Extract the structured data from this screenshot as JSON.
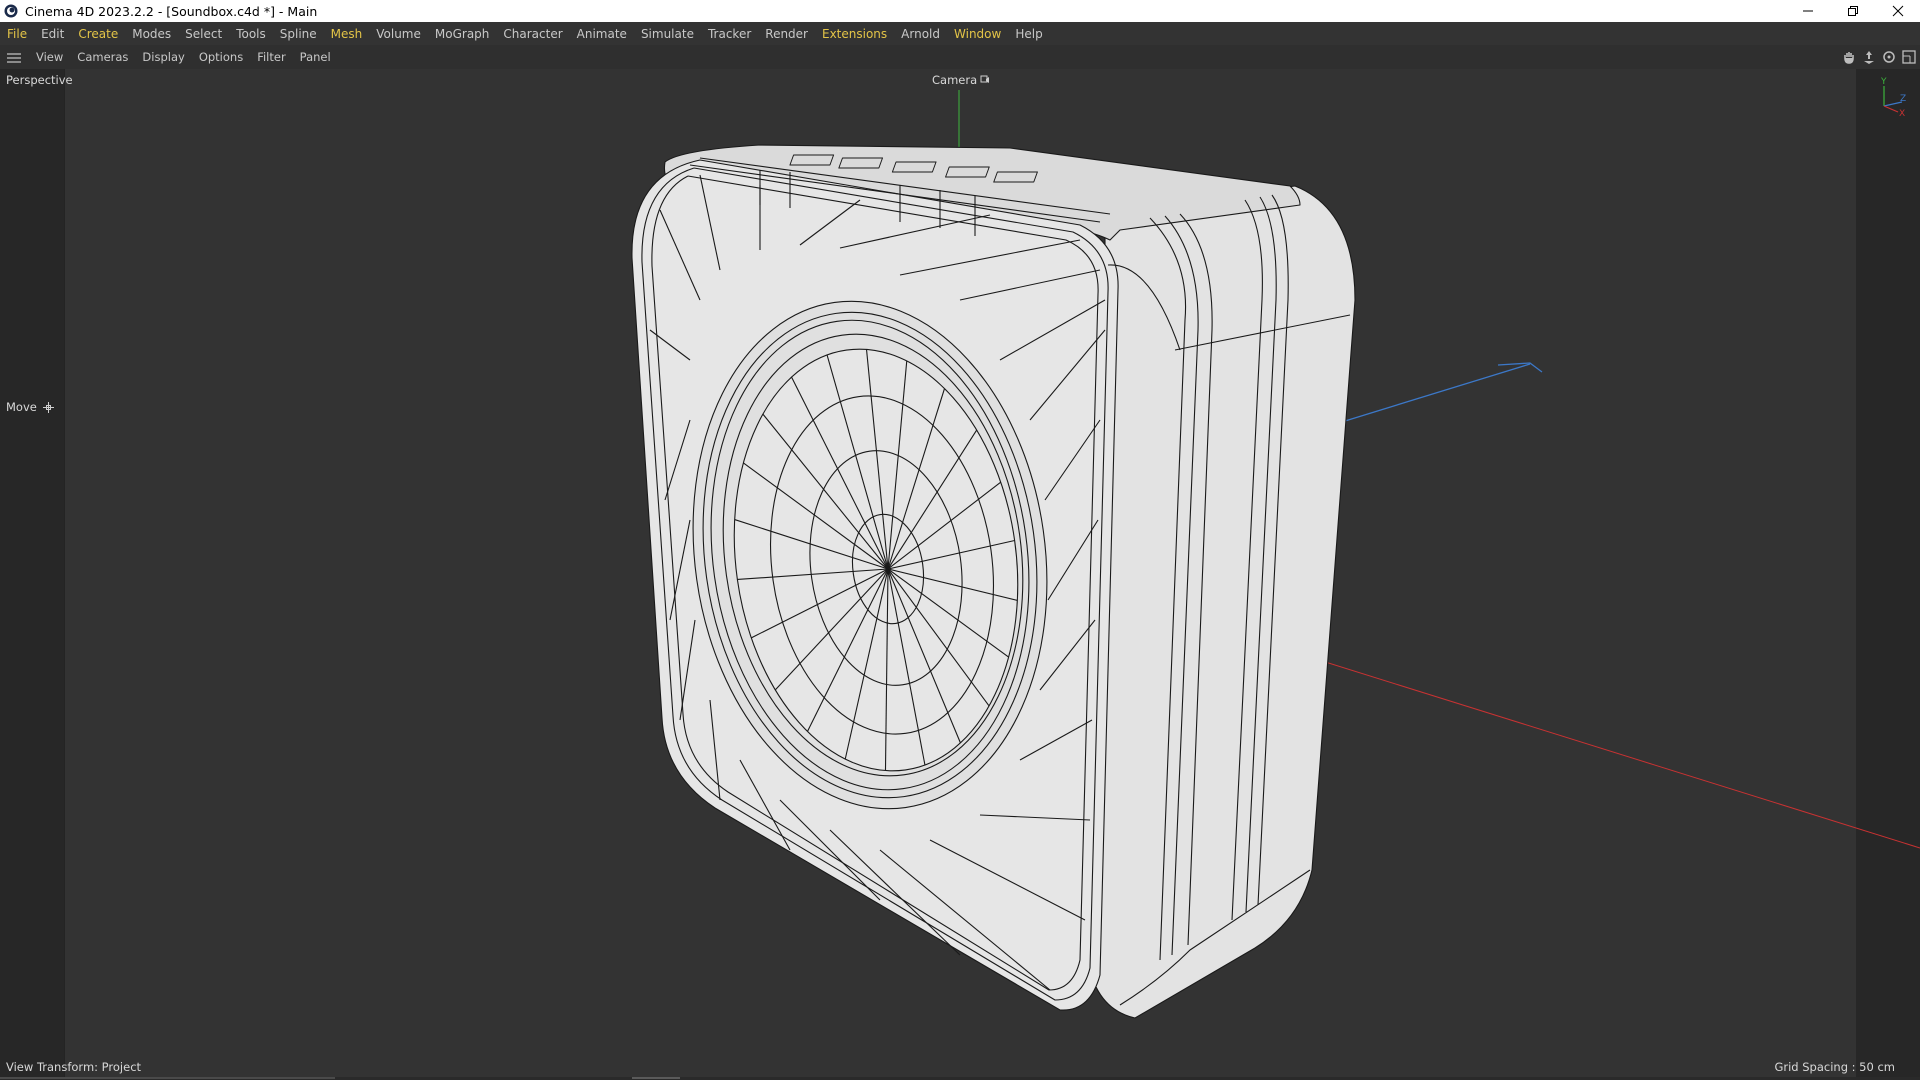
{
  "window": {
    "title": "Cinema 4D 2023.2.2 - [Soundbox.c4d *] - Main",
    "controls": [
      "minimize-icon",
      "restore-icon",
      "close-icon"
    ]
  },
  "menubar": {
    "items": [
      {
        "label": "File",
        "highlight": true
      },
      {
        "label": "Edit",
        "highlight": false
      },
      {
        "label": "Create",
        "highlight": true
      },
      {
        "label": "Modes",
        "highlight": false
      },
      {
        "label": "Select",
        "highlight": false
      },
      {
        "label": "Tools",
        "highlight": false
      },
      {
        "label": "Spline",
        "highlight": false
      },
      {
        "label": "Mesh",
        "highlight": true
      },
      {
        "label": "Volume",
        "highlight": false
      },
      {
        "label": "MoGraph",
        "highlight": false
      },
      {
        "label": "Character",
        "highlight": false
      },
      {
        "label": "Animate",
        "highlight": false
      },
      {
        "label": "Simulate",
        "highlight": false
      },
      {
        "label": "Tracker",
        "highlight": false
      },
      {
        "label": "Render",
        "highlight": false
      },
      {
        "label": "Extensions",
        "highlight": true
      },
      {
        "label": "Arnold",
        "highlight": false
      },
      {
        "label": "Window",
        "highlight": true
      },
      {
        "label": "Help",
        "highlight": false
      }
    ],
    "highlight_color": "#e3c447"
  },
  "viewport_menu": {
    "items": [
      "View",
      "Cameras",
      "Display",
      "Options",
      "Filter",
      "Panel"
    ],
    "nav_icons": [
      "pan-hand-icon",
      "move-camera-icon",
      "rotate-camera-icon",
      "maximize-view-icon"
    ]
  },
  "viewport": {
    "name": "Perspective",
    "camera": "Camera",
    "active_tool": "Move",
    "view_transform": "View Transform: Project",
    "grid_spacing": "Grid Spacing : 50 cm",
    "axis_gizmo": [
      "Y",
      "Z",
      "X"
    ],
    "axis_colors": {
      "x": "#c83232",
      "y": "#3cb43c",
      "z": "#3c78c8"
    }
  }
}
